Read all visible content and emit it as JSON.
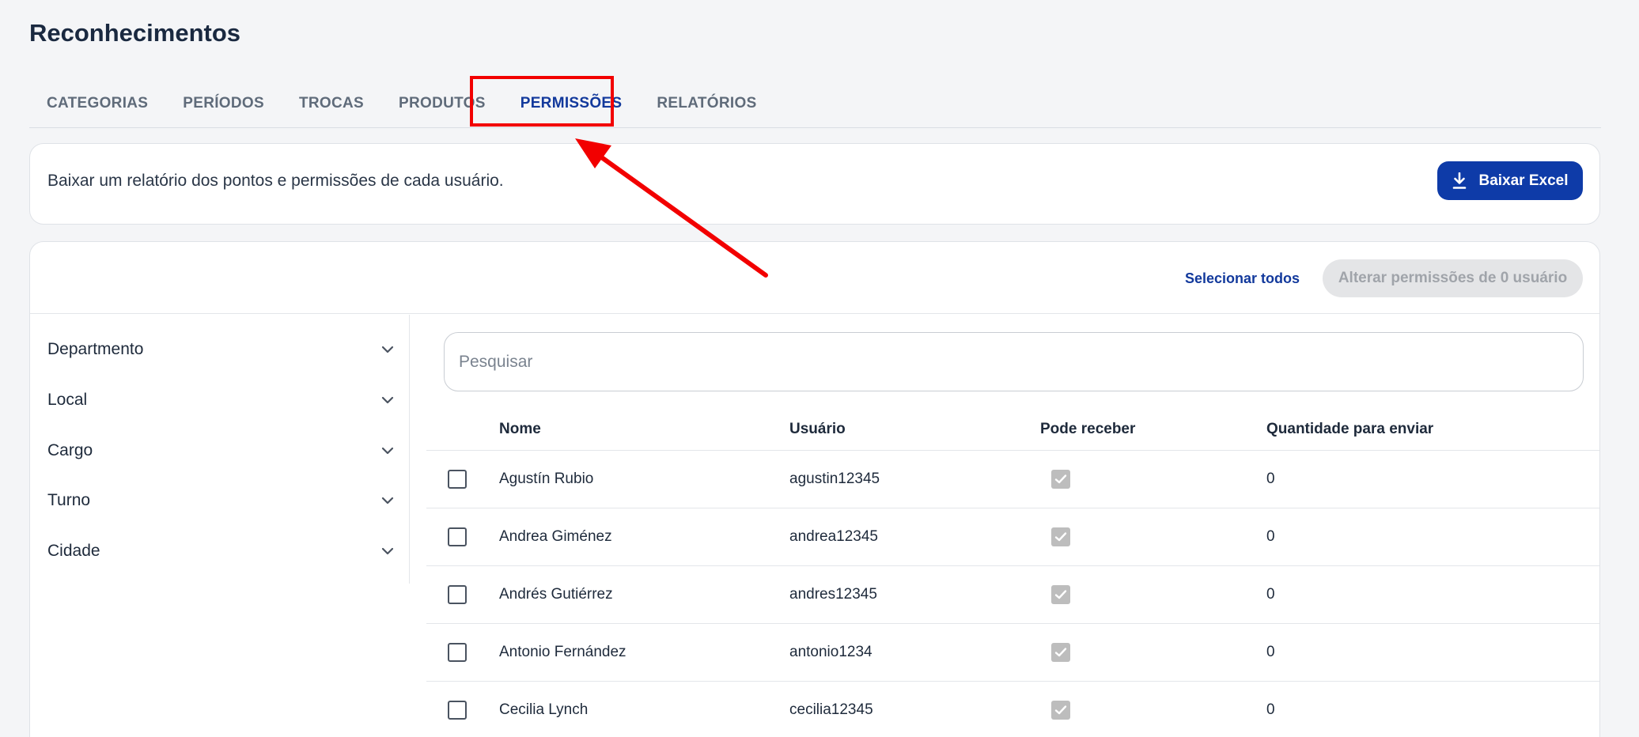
{
  "page": {
    "title": "Reconhecimentos"
  },
  "tabs": [
    {
      "label": "CATEGORIAS",
      "active": false
    },
    {
      "label": "PERÍODOS",
      "active": false
    },
    {
      "label": "TROCAS",
      "active": false
    },
    {
      "label": "PRODUTOS",
      "active": false
    },
    {
      "label": "PERMISSÕES",
      "active": true
    },
    {
      "label": "RELATÓRIOS",
      "active": false
    }
  ],
  "report": {
    "description": "Baixar um relatório dos pontos e permissões de cada usuário.",
    "button_label": "Baixar Excel"
  },
  "toolbar": {
    "select_all": "Selecionar todos",
    "alter_button": "Alterar permissões de 0 usuário"
  },
  "filters": [
    {
      "label": "Departmento"
    },
    {
      "label": "Local"
    },
    {
      "label": "Cargo"
    },
    {
      "label": "Turno"
    },
    {
      "label": "Cidade"
    }
  ],
  "search": {
    "placeholder": "Pesquisar",
    "value": ""
  },
  "table": {
    "columns": [
      "Nome",
      "Usuário",
      "Pode receber",
      "Quantidade para enviar"
    ],
    "rows": [
      {
        "name": "Agustín Rubio",
        "user": "agustin12345",
        "can_receive": true,
        "qty": "0"
      },
      {
        "name": "Andrea Giménez",
        "user": "andrea12345",
        "can_receive": true,
        "qty": "0"
      },
      {
        "name": "Andrés Gutiérrez",
        "user": "andres12345",
        "can_receive": true,
        "qty": "0"
      },
      {
        "name": "Antonio Fernández",
        "user": "antonio1234",
        "can_receive": true,
        "qty": "0"
      },
      {
        "name": "Cecilia Lynch",
        "user": "cecilia12345",
        "can_receive": true,
        "qty": "0"
      }
    ]
  },
  "colors": {
    "primary": "#0e3ba8",
    "active_tab": "#12399c",
    "annotation": "#f20000",
    "disabled_check": "#bdbdbd"
  },
  "icons": {
    "download": "download-icon",
    "chevron": "chevron-down-icon",
    "check": "check-icon"
  }
}
